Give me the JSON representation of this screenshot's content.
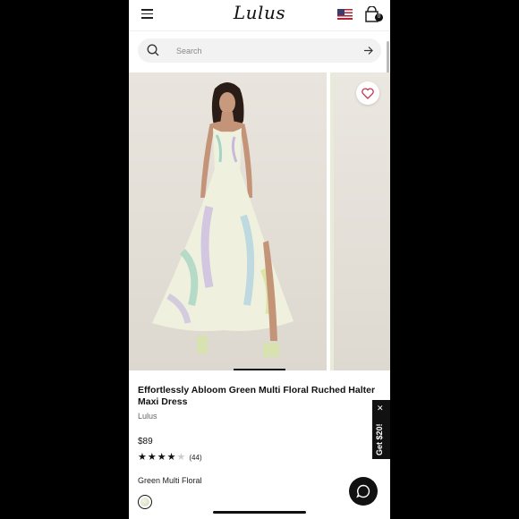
{
  "header": {
    "logo_text": "Lulus",
    "menu_icon": "hamburger-icon",
    "flag_icon": "us-flag-icon",
    "bag_icon": "shopping-bag-icon",
    "bag_count": "0"
  },
  "search": {
    "placeholder": "Search",
    "icon": "search-icon",
    "submit_icon": "arrow-right-icon"
  },
  "gallery": {
    "wishlist_icon": "heart-icon",
    "slide_count_visible": 2
  },
  "product": {
    "title": "Effortlessly Abloom Green Multi Floral Ruched Halter Maxi Dress",
    "brand": "Lulus",
    "price": "$89",
    "rating": 4,
    "rating_max": 5,
    "review_count": "(44)",
    "color_name": "Green Multi Floral"
  },
  "promo": {
    "label": "Get $20!",
    "close_label": "✕"
  },
  "chat": {
    "icon": "chat-bubble-icon"
  },
  "colors": {
    "text": "#111111",
    "muted": "#666666",
    "search_bg": "#f2f2f2",
    "heart": "#c0344a"
  }
}
